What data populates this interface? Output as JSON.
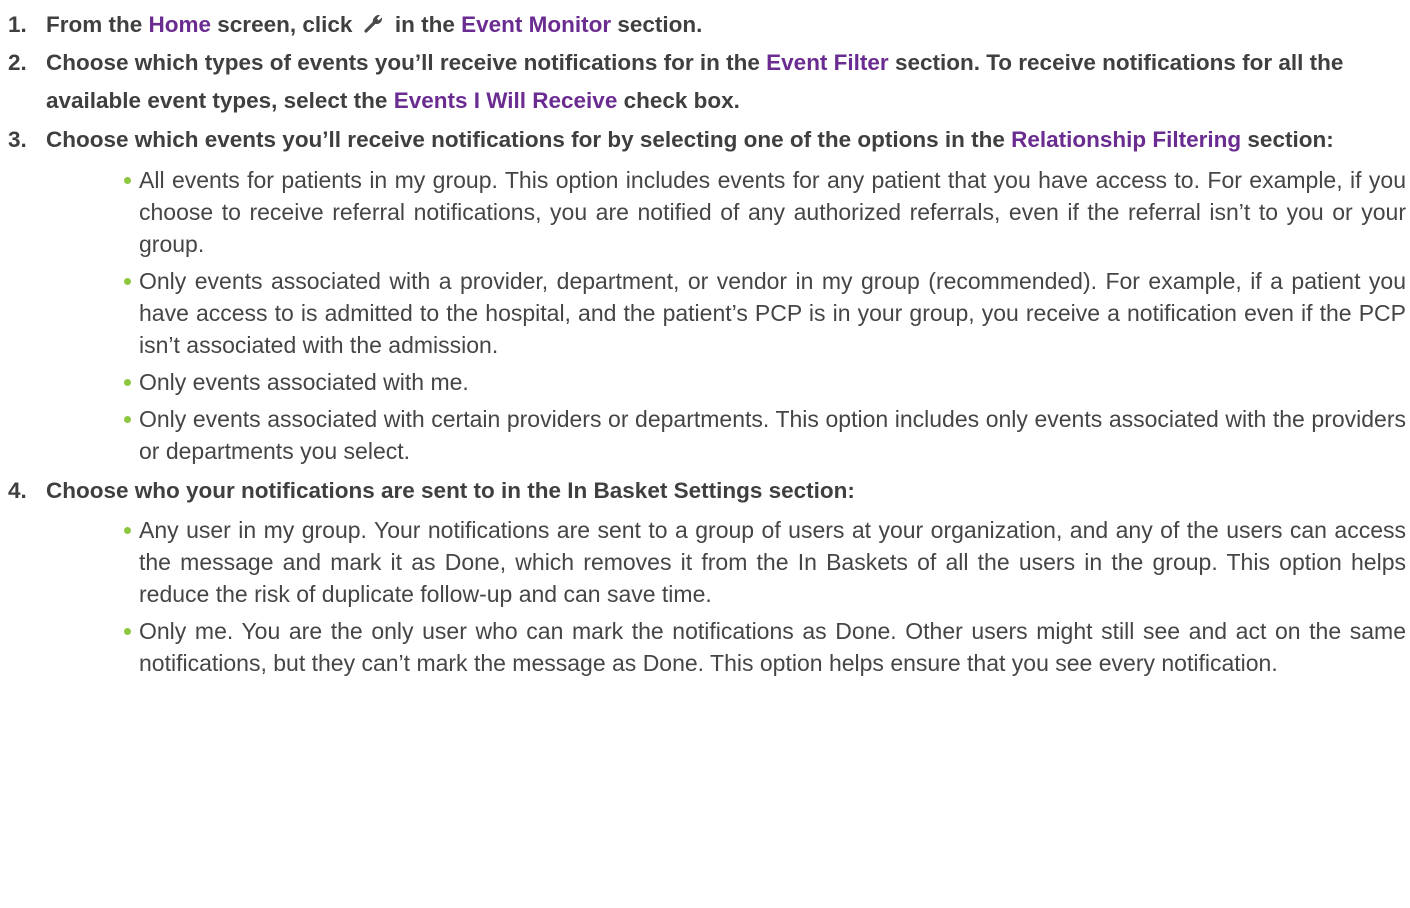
{
  "colors": {
    "highlight": "#6b2c91",
    "bullet": "#8dc63f",
    "text": "#3f3f3f"
  },
  "steps": [
    {
      "num": "1.",
      "t1": "From the ",
      "h1": "Home",
      "t2": " screen, click ",
      "icon": "wrench-icon",
      "t3": " in the ",
      "h2": "Event Monitor",
      "t4": " section."
    },
    {
      "num": "2.",
      "t1": "Choose which types of events you’ll receive notifications for in the ",
      "h1": "Event Filter",
      "t2": " section. To receive notifications for all the available event types, select the ",
      "h2": "Events I Will Receive",
      "t3": " check box."
    },
    {
      "num": "3.",
      "t1": "Choose which events you’ll receive notifications for by selecting one of the options in the ",
      "h1": "Relationship Filtering",
      "t2": " section:",
      "bullets": [
        "All events for patients in my group. This option includes events for any patient that you have access to. For example, if you choose to receive referral notifications, you are notified of any authorized referrals, even if the referral isn’t to you or your group.",
        "Only events associated with a provider, department, or vendor in my group (recommended). For example, if a patient you have access to is admitted to the hospital, and the patient’s PCP is in your group, you receive a notification even if the PCP isn’t associated with the admission.",
        "Only events associated with me.",
        "Only events associated with certain providers or departments. This option includes only events associated with the providers or departments you select."
      ]
    },
    {
      "num": "4.",
      "t1": "Choose who your notifications are sent to in the In Basket Settings section:",
      "bullets": [
        "Any user in my group. Your notifications are sent to a group of users at your organization, and any of the users can access the message and mark it as Done, which removes it from the In Baskets of all the users in the group. This option helps reduce the risk of duplicate follow-up and can save time.",
        "Only me. You are the only user who can mark the notifications as Done. Other users might still see and act on the same notifications, but they can’t mark the message as Done. This option helps ensure that you see every notification."
      ]
    }
  ]
}
